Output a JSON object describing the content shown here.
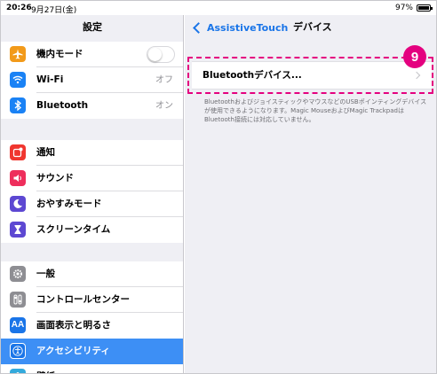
{
  "status_bar": {
    "time": "20:26",
    "date": "9月27日(金)",
    "battery": "97%"
  },
  "left": {
    "title": "設定",
    "groups": [
      {
        "items": [
          {
            "label": "機内モード",
            "icon": "airplane-icon",
            "color": "#f29a1a",
            "toggle": false
          },
          {
            "label": "Wi-Fi",
            "icon": "wifi-icon",
            "color": "#1a82f5",
            "value": "オフ"
          },
          {
            "label": "Bluetooth",
            "icon": "bluetooth-icon",
            "color": "#1a82f5",
            "value": "オン"
          }
        ]
      },
      {
        "items": [
          {
            "label": "通知",
            "icon": "notification-icon",
            "color": "#f0362f"
          },
          {
            "label": "サウンド",
            "icon": "sound-icon",
            "color": "#ee2e5c"
          },
          {
            "label": "おやすみモード",
            "icon": "moon-icon",
            "color": "#5d48d2"
          },
          {
            "label": "スクリーンタイム",
            "icon": "hourglass-icon",
            "color": "#5d48d2"
          }
        ]
      },
      {
        "items": [
          {
            "label": "一般",
            "icon": "gear-icon",
            "color": "#8e8e93"
          },
          {
            "label": "コントロールセンター",
            "icon": "control-center-icon",
            "color": "#8e8e93"
          },
          {
            "label": "画面表示と明るさ",
            "icon": "display-brightness-icon",
            "color": "#1a75e8"
          },
          {
            "label": "アクセシビリティ",
            "icon": "accessibility-icon",
            "color": "#1a75e8",
            "selected": true
          },
          {
            "label": "壁紙",
            "icon": "wallpaper-icon",
            "color": "#34aadc"
          }
        ]
      }
    ]
  },
  "right": {
    "back_label": "AssistiveTouch",
    "title": "デバイス",
    "bluetooth_devices_label": "Bluetoothデバイス...",
    "footnote": "BluetoothおよびジョイスティックやマウスなどのUSBポインティングデバイスが使用できるようになります。Magic MouseおよびMagic TrackpadはBluetooth接続には対応していません。",
    "step_number": "9",
    "highlight_color": "#e4007f"
  }
}
